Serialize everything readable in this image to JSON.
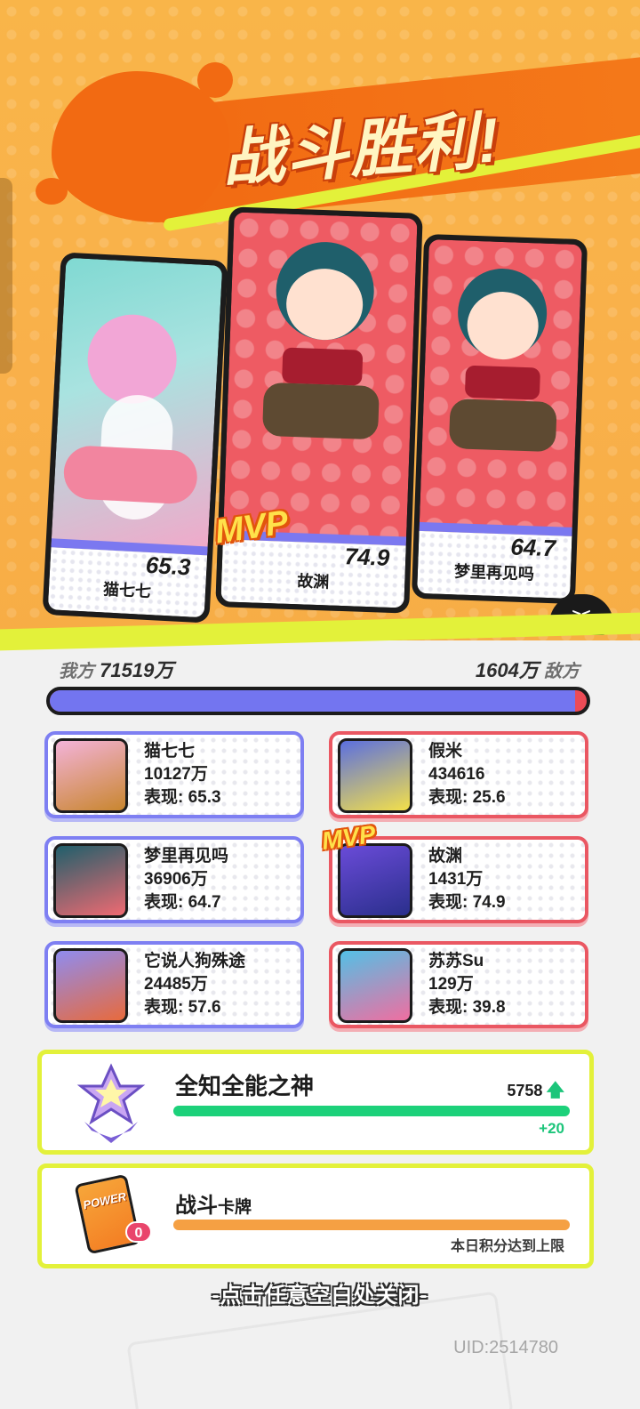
{
  "title": "战斗胜利!",
  "mvp_label": "MVP",
  "ghost_face": "><",
  "cards": [
    {
      "name": "猫七七",
      "score": "65.3"
    },
    {
      "name": "故渊",
      "score": "74.9"
    },
    {
      "name": "梦里再见吗",
      "score": "64.7"
    }
  ],
  "team": {
    "ally_label": "我方",
    "ally_value": "71519万",
    "enemy_value": "1604万",
    "enemy_label": "敌方",
    "ally_share": 0.978,
    "ally_color": "#7375f0",
    "enemy_color": "#ec4b56"
  },
  "allies": [
    {
      "name": "猫七七",
      "damage": "10127万",
      "perf": "表现: 65.3"
    },
    {
      "name": "梦里再见吗",
      "damage": "36906万",
      "perf": "表现: 64.7"
    },
    {
      "name": "它说人狗殊途",
      "damage": "24485万",
      "perf": "表现: 57.6"
    }
  ],
  "enemies": [
    {
      "name": "假米",
      "damage": "434616",
      "perf": "表现: 25.6"
    },
    {
      "name": "故渊",
      "damage": "1431万",
      "perf": "表现: 74.9"
    },
    {
      "name": "苏苏Su",
      "damage": "129万",
      "perf": "表现: 39.8"
    }
  ],
  "rank": {
    "title": "全知全能之神",
    "points": "5758",
    "arrow_icon": "up-arrow-icon",
    "gain": "+20",
    "progress": 1.0,
    "color": "#1cd17a"
  },
  "battle_card": {
    "title": "战斗",
    "title_suffix": "卡牌",
    "power_label": "POWER",
    "count": "0",
    "note": "本日积分达到上限",
    "progress": 1.0,
    "color": "#f5a043"
  },
  "close_hint": "-点击任意空白处关闭-",
  "uid": "UID:2514780"
}
